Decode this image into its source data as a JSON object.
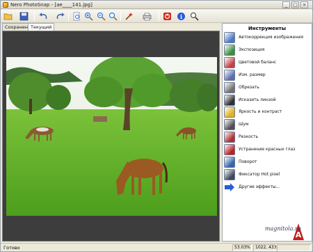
{
  "window": {
    "title": "Nero PhotoSnap - [ae____141.jpg]",
    "minimize": "_",
    "maximize": "□",
    "close": "×"
  },
  "toolbar": {
    "icons": [
      "open-folder-icon",
      "save-icon",
      "undo-icon",
      "redo-icon",
      "zoom-page-icon",
      "zoom-in-icon",
      "zoom-out-icon",
      "zoom-fit-icon",
      "magic-wand-icon",
      "print-icon",
      "stop-icon",
      "info-icon",
      "help-icon"
    ]
  },
  "tabs": [
    {
      "label": "Сохранено",
      "active": false
    },
    {
      "label": "Текущий",
      "active": true
    }
  ],
  "panel": {
    "title": "Инструменты",
    "tools": [
      {
        "label": "Автокоррекция изображения",
        "icon": "auto-correct-icon",
        "color": "#4a79c9"
      },
      {
        "label": "Экспозиция",
        "icon": "exposure-icon",
        "color": "#3c8f3c"
      },
      {
        "label": "Цветовой баланс",
        "icon": "color-balance-icon",
        "color": "#c94040"
      },
      {
        "label": "Изм. размер",
        "icon": "resize-icon",
        "color": "#5b6bb0"
      },
      {
        "label": "Обрезать",
        "icon": "crop-icon",
        "color": "#707070"
      },
      {
        "label": "Исказить линзой",
        "icon": "lens-distort-icon",
        "color": "#303030"
      },
      {
        "label": "Яркость и контраст",
        "icon": "brightness-contrast-icon",
        "color": "#e0b020"
      },
      {
        "label": "Шум",
        "icon": "noise-icon",
        "color": "#505050"
      },
      {
        "label": "Резкость",
        "icon": "sharpness-icon",
        "color": "#b03030"
      },
      {
        "label": "Устранение красных глаз",
        "icon": "red-eye-icon",
        "color": "#c02020"
      },
      {
        "label": "Поворот",
        "icon": "rotate-icon",
        "color": "#3366aa"
      },
      {
        "label": "Фиксатор Hot pixel",
        "icon": "hot-pixel-icon",
        "color": "#404a5a"
      },
      {
        "label": "Другие эффекты...",
        "icon": "arrow-right-icon",
        "color": "#2a5bd7"
      }
    ]
  },
  "watermark": "magnitola.ru",
  "status": {
    "text": "Готово",
    "zoom": "53.03%",
    "coords": "1022, 433"
  }
}
